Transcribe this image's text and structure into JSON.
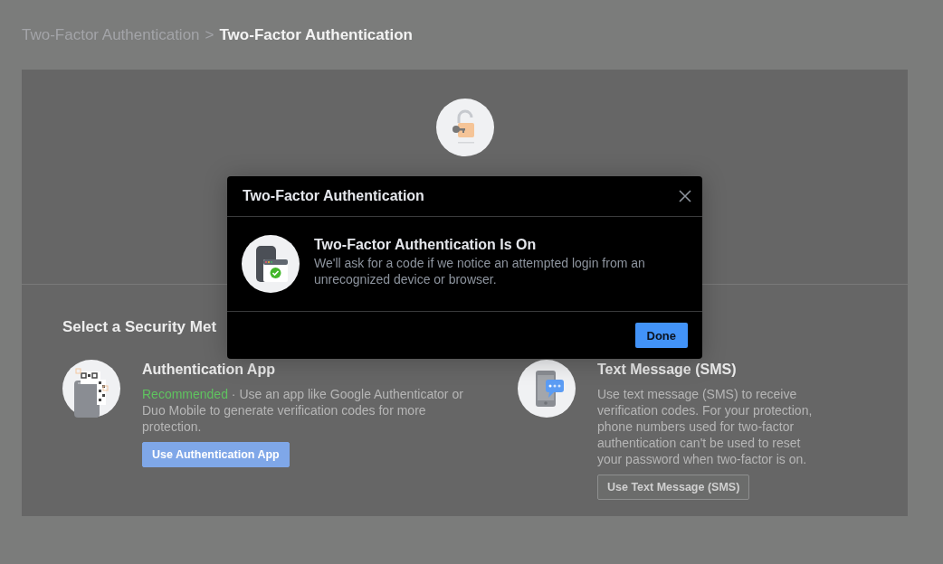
{
  "breadcrumb": [
    {
      "label": "Two-Factor Authentication",
      "current": false
    },
    {
      "label": "Two-Factor Authentication",
      "current": true
    }
  ],
  "breadcrumb_separator": ">",
  "section_title": "Select a Security Met",
  "methods": [
    {
      "kind": "app",
      "title": "Authentication App",
      "badge": "Recommended",
      "description": " · Use an app like Google Authenticator or Duo Mobile to generate verification codes for more protection.",
      "button": "Use Authentication App",
      "primary": true
    },
    {
      "kind": "sms",
      "title": "Text Message (SMS)",
      "description": "Use text message (SMS) to receive verification codes. For your protection, phone numbers used for two-factor authentication can't be used to reset your password when two-factor is on.",
      "button": "Use Text Message (SMS)",
      "primary": false
    }
  ],
  "dialog": {
    "title": "Two-Factor Authentication",
    "status_title": "Two-Factor Authentication Is On",
    "status_text": "We'll ask for a code if we notice an attempted login from an unrecognized device or browser.",
    "button": "Done"
  }
}
